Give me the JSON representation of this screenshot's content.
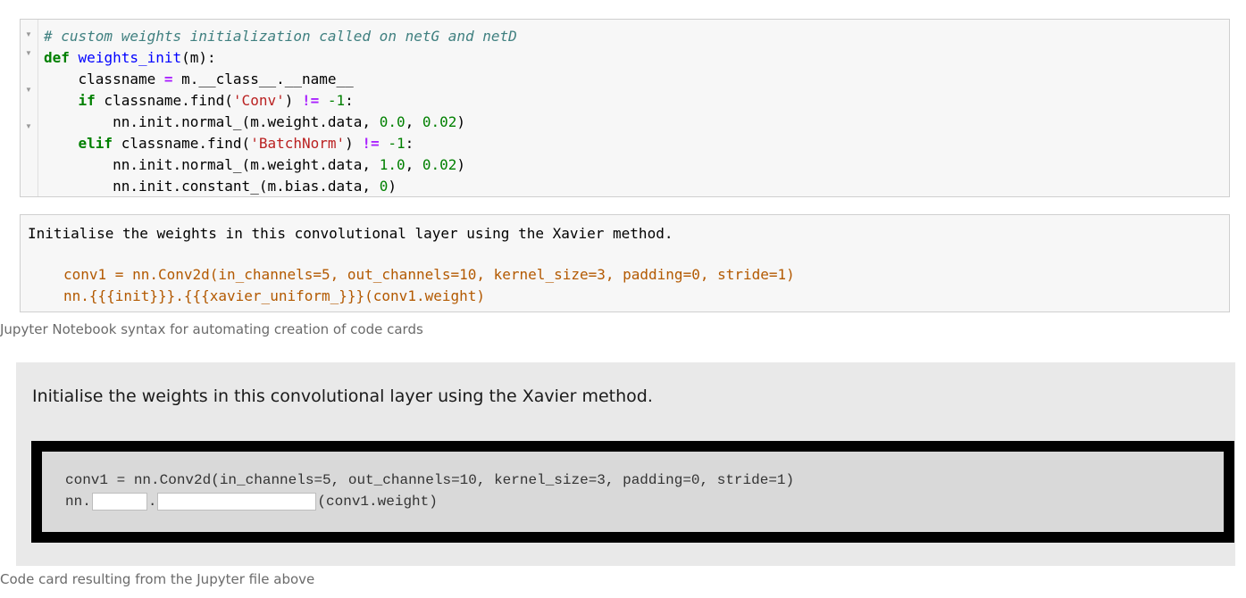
{
  "code_cell": {
    "line1": {
      "comment": "# custom weights initialization called on netG and netD"
    },
    "line2": {
      "kw": "def",
      "name": "weights_init",
      "rest": "(m):"
    },
    "line3": {
      "indent": "    ",
      "a": "classname ",
      "op": "=",
      "b": " m.__class__.__name__"
    },
    "line4": {
      "indent": "    ",
      "kw": "if",
      "a": " classname.find(",
      "str": "'Conv'",
      "b": ") ",
      "op": "!=",
      "c": " ",
      "num": "-1",
      "d": ":"
    },
    "line5": {
      "indent": "        ",
      "a": "nn.init.normal_(m.weight.data, ",
      "n1": "0.0",
      "b": ", ",
      "n2": "0.02",
      "c": ")"
    },
    "line6": {
      "indent": "    ",
      "kw": "elif",
      "a": " classname.find(",
      "str": "'BatchNorm'",
      "b": ") ",
      "op": "!=",
      "c": " ",
      "num": "-1",
      "d": ":"
    },
    "line7": {
      "indent": "        ",
      "a": "nn.init.normal_(m.weight.data, ",
      "n1": "1.0",
      "b": ", ",
      "n2": "0.02",
      "c": ")"
    },
    "line8": {
      "indent": "        ",
      "a": "nn.init.constant_(m.bias.data, ",
      "n1": "0",
      "c": ")"
    }
  },
  "md_cell": {
    "text": "Initialise the weights in this convolutional layer using the Xavier method.",
    "code_line1": "conv1 = nn.Conv2d(in_channels=5, out_channels=10, kernel_size=3, padding=0, stride=1)",
    "code_line2": "nn.{{{init}}}.{{{xavier_uniform_}}}(conv1.weight)"
  },
  "caption1": "Jupyter Notebook syntax for automating creation of code cards",
  "card": {
    "question": "Initialise the weights in this convolutional layer using the Xavier method.",
    "code_line1": "conv1 = nn.Conv2d(in_channels=5, out_channels=10, kernel_size=3, padding=0, stride=1)",
    "line2_prefix": "nn.",
    "line2_sep": ".",
    "line2_suffix": "(conv1.weight)",
    "blank1_value": "",
    "blank2_value": ""
  },
  "caption2": "Code card resulting from the Jupyter file above",
  "colors": {
    "comment": "#408080",
    "keyword": "#008000",
    "function_name": "#0000ff",
    "operator": "#aa22ff",
    "string": "#ba2121",
    "md_code": "#b35900",
    "card_frame": "#000000",
    "card_bg": "#e9e9e9"
  },
  "icons": {
    "fold_marker": "fold-triangle-icon"
  }
}
